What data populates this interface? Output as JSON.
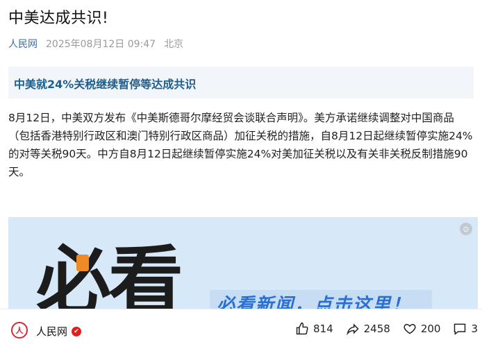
{
  "article": {
    "title": "中美达成共识!",
    "source": "人民网",
    "date": "2025年08月12日 09:47",
    "location": "北京",
    "headline": "中美就24%关税继续暂停等达成共识",
    "paragraph": "8月12日，中美双方发布《中美斯德哥尔摩经贸会谈联合声明》。美方承诺继续调整对中国商品（包括香港特别行政区和澳门特别行政区商品）加征关税的措施，自8月12日起继续暂停实施24%的对等关税90天。中方自8月12日起继续暂停实施24%对美加征关税以及有关非关税反制措施90天。"
  },
  "banner": {
    "big_text": "必看",
    "slogan": "必看新闻，点击这里！"
  },
  "footer": {
    "account_name": "人民网",
    "logo_text": "人",
    "likes": "814",
    "shares": "2458",
    "favorites": "200",
    "comments": "3"
  },
  "colors": {
    "headline": "#1b5f8f",
    "banner_bg": "#d7e8f8",
    "accent_orange": "#f08a24",
    "slogan": "#2a6fd1"
  }
}
